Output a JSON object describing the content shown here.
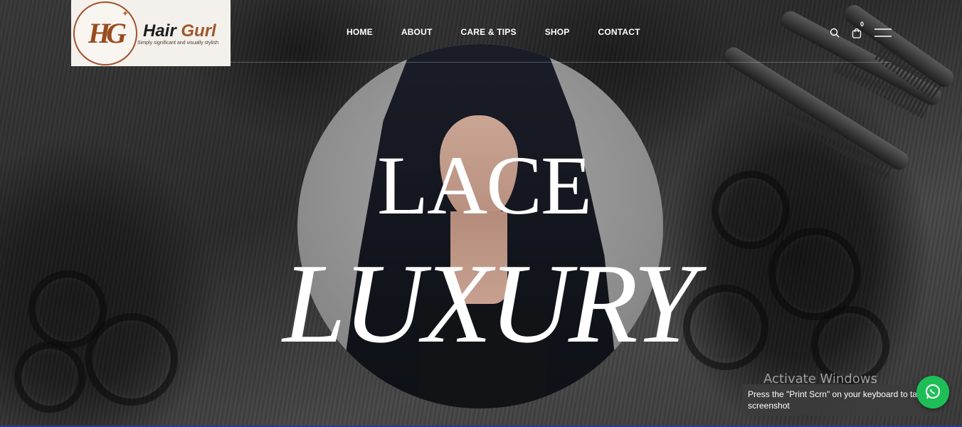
{
  "brand": {
    "mark": "HG",
    "name_part1": "Hair ",
    "name_part2": "Gurl",
    "tagline": "Simply significant and visually stylish"
  },
  "nav": {
    "items": [
      {
        "label": "HOME"
      },
      {
        "label": "ABOUT"
      },
      {
        "label": "CARE & TIPS"
      },
      {
        "label": "SHOP"
      },
      {
        "label": "CONTACT"
      }
    ]
  },
  "header_icons": {
    "search": "search-icon",
    "cart": "shopping-bag-icon",
    "cart_count": "0",
    "menu": "hamburger-menu-icon"
  },
  "hero": {
    "title_line1": "LACE",
    "title_line2": "LUXURY"
  },
  "overlay": {
    "activate_text": "Activate Windows",
    "toast_text": "Press the \"Print Scrn\" on your keyboard to take a screenshot"
  },
  "floating": {
    "whatsapp": "whatsapp-icon"
  },
  "colors": {
    "brand_brown": "#a0572a",
    "whatsapp_green": "#1ebe57",
    "text_white": "#ffffff"
  }
}
